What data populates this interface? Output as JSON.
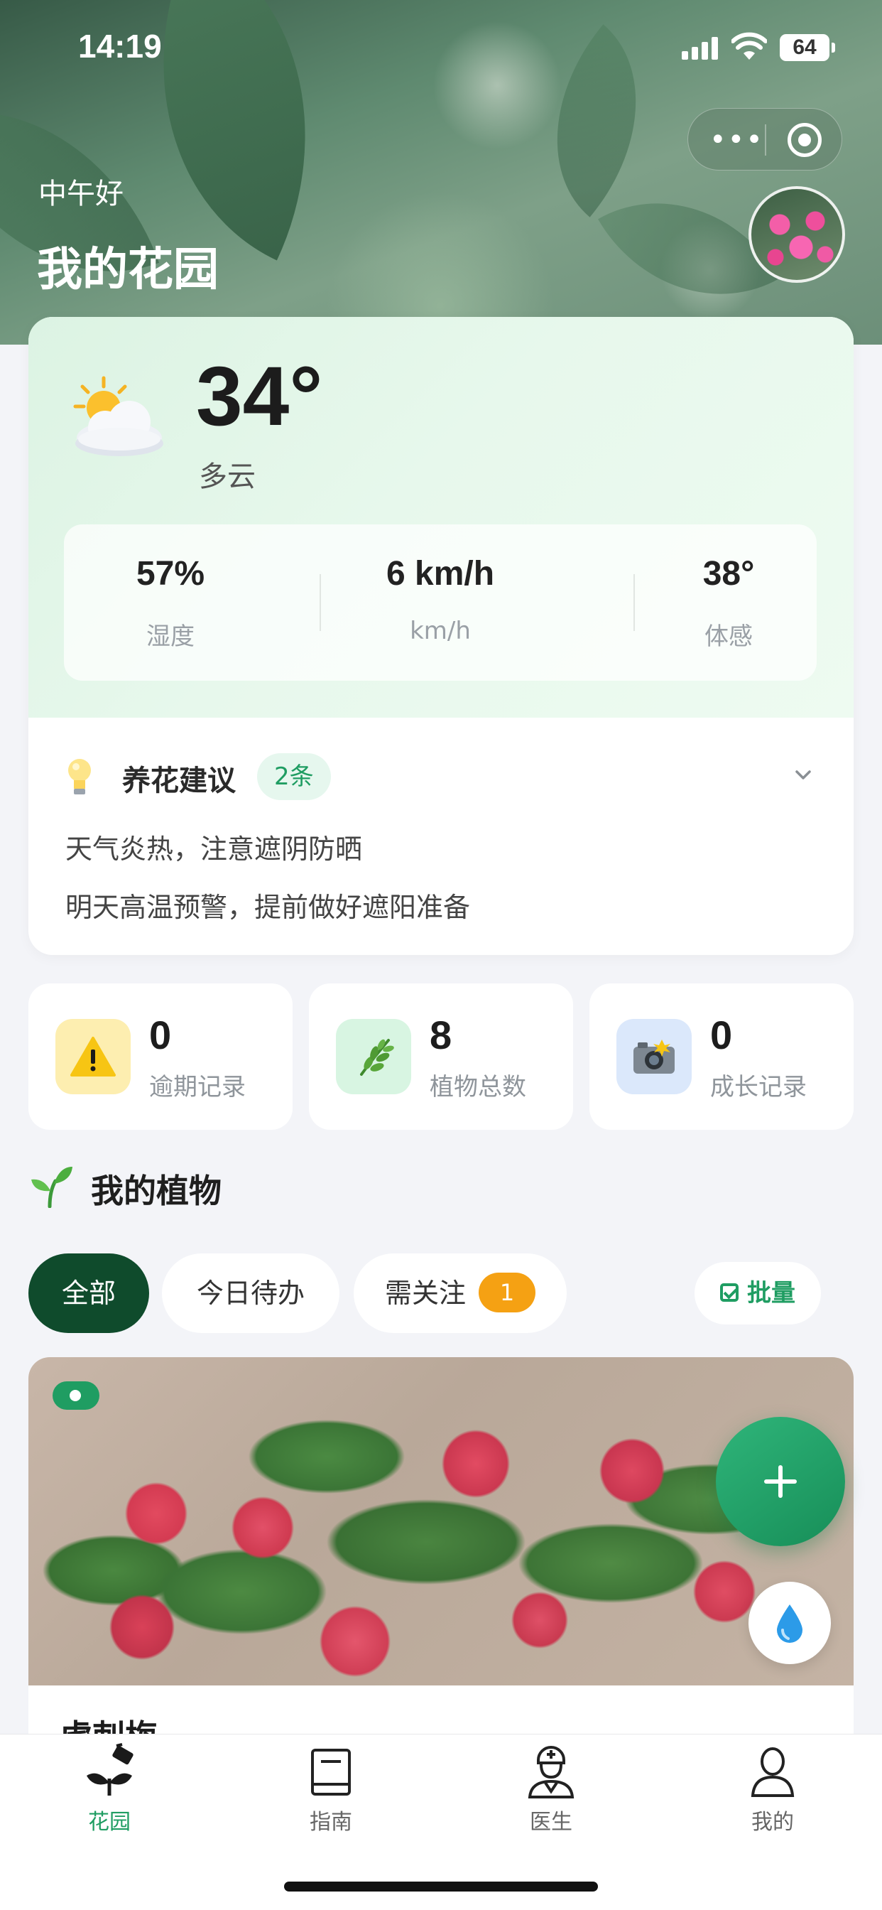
{
  "status_bar": {
    "time": "14:19",
    "battery": "64"
  },
  "header": {
    "greeting": "中午好",
    "title": "我的花园",
    "capsule_dots": "•••"
  },
  "weather": {
    "icon": "sun-behind-cloud-icon",
    "temperature": "34°",
    "condition": "多云",
    "metrics": [
      {
        "value": "57%",
        "label": "湿度"
      },
      {
        "value": "6 km/h",
        "label": "km/h"
      },
      {
        "value": "38°",
        "label": "体感"
      }
    ]
  },
  "tips": {
    "title": "养花建议",
    "badge": "2条",
    "items": [
      "天气炎热，注意遮阴防晒",
      "明天高温预警，提前做好遮阳准备"
    ]
  },
  "stats": [
    {
      "value": "0",
      "label": "逾期记录",
      "icon": "warning-icon",
      "bg": "#fdeeb0"
    },
    {
      "value": "8",
      "label": "植物总数",
      "icon": "herb-icon",
      "bg": "#d8f5e2"
    },
    {
      "value": "0",
      "label": "成长记录",
      "icon": "camera-icon",
      "bg": "#dbe8fb"
    }
  ],
  "plants_section": {
    "title": "我的植物",
    "filters": [
      {
        "label": "全部",
        "active": true
      },
      {
        "label": "今日待办",
        "active": false
      },
      {
        "label": "需关注",
        "count": "1",
        "active": false
      }
    ],
    "batch_label": "批量"
  },
  "plant_card": {
    "name": "虎刺梅",
    "status_color": "#1f9d62"
  },
  "tabbar": {
    "tabs": [
      {
        "label": "花园",
        "icon": "garden-icon",
        "active": true
      },
      {
        "label": "指南",
        "icon": "book-icon",
        "active": false
      },
      {
        "label": "医生",
        "icon": "doctor-icon",
        "active": false
      },
      {
        "label": "我的",
        "icon": "profile-icon",
        "active": false
      }
    ]
  },
  "colors": {
    "accent": "#1f9d62",
    "dark_green": "#0f4b2c",
    "warning": "#f5a113"
  }
}
